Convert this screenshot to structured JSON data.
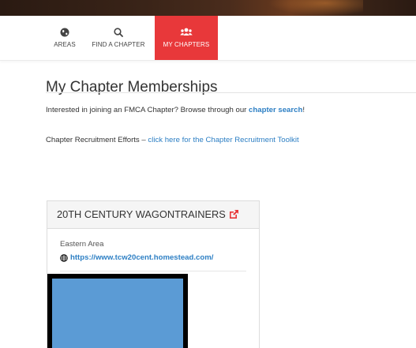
{
  "nav": {
    "tabs": [
      {
        "label": "AREAS",
        "icon": "globe-icon"
      },
      {
        "label": "FIND A CHAPTER",
        "icon": "search-icon"
      },
      {
        "label": "MY CHAPTERS",
        "icon": "users-icon"
      }
    ],
    "active_tab": "MY CHAPTERS",
    "active_color": "#e8383a"
  },
  "page": {
    "title": "My Chapter Memberships",
    "intro_text": "Interested in joining an FMCA Chapter? Browse through our ",
    "intro_link": "chapter search",
    "intro_end": "!",
    "recruit_text": "Chapter Recruitment Efforts – ",
    "recruit_link": "click here for the Chapter Recruitment Toolkit"
  },
  "chapters": [
    {
      "name": "20TH CENTURY WAGONTRAINERS",
      "external_icon": "external-link-icon",
      "area": "Eastern Area",
      "website": "https://www.tcw20cent.homestead.com/",
      "logo_color": "#5b9bd5"
    }
  ],
  "colors": {
    "link": "#2d7fc4",
    "accent": "#e8383a"
  }
}
